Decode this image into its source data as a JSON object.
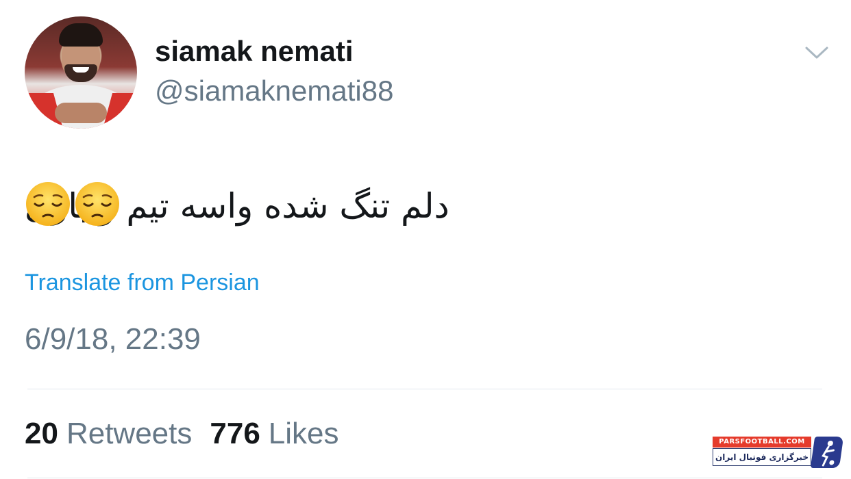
{
  "user": {
    "display_name": "siamak nemati",
    "handle": "@siamaknemati88"
  },
  "tweet": {
    "text": "دلم تنگ شده واسه تیم و بازی",
    "emojis": [
      "pensive-face-emoji",
      "pensive-face-emoji"
    ],
    "translate_link": "Translate from Persian",
    "timestamp": "6/9/18, 22:39"
  },
  "stats": {
    "retweets_count": "20",
    "retweets_label": "Retweets",
    "likes_count": "776",
    "likes_label": "Likes"
  },
  "watermark": {
    "site": "PARSFOOTBALL.COM",
    "tagline": "خبرگزاری فوتبال ایران"
  },
  "colors": {
    "text_primary": "#14171a",
    "text_secondary": "#657786",
    "link": "#1b95e0",
    "divider": "#e1e8ed"
  }
}
